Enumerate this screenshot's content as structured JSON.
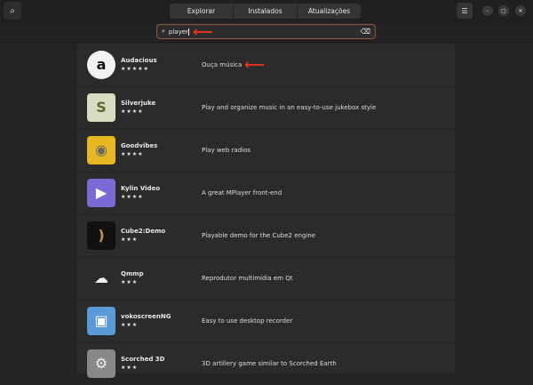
{
  "header": {
    "tabs": [
      "Explorar",
      "Instalados",
      "Atualizações"
    ]
  },
  "search": {
    "value": "player"
  },
  "apps": [
    {
      "name": "Audacious",
      "stars": "★★★★★",
      "desc": "Ouça música",
      "icon": "audacious-icon",
      "bg": "#f2f2f2",
      "glyph": "a",
      "fg": "#111"
    },
    {
      "name": "Silverjuke",
      "stars": "★★★★",
      "desc": "Play and organize music in an easy-to-use jukebox style",
      "icon": "silverjuke-icon",
      "bg": "#d8dcc0",
      "glyph": "S",
      "fg": "#5a6a30"
    },
    {
      "name": "Goodvibes",
      "stars": "★★★★",
      "desc": "Play web radios",
      "icon": "radio-icon",
      "bg": "#e8b820",
      "glyph": "◉",
      "fg": "#666"
    },
    {
      "name": "Kylin Video",
      "stars": "★★★★",
      "desc": "A great MPlayer front-end",
      "icon": "play-icon",
      "bg": "#7a6ad8",
      "glyph": "▶",
      "fg": "#fff"
    },
    {
      "name": "Cube2:Demo",
      "stars": "★★★",
      "desc": "Playable demo for the Cube2 engine",
      "icon": "cube2-icon",
      "bg": "#111",
      "glyph": ")",
      "fg": "#c89040"
    },
    {
      "name": "Qmmp",
      "stars": "★★★",
      "desc": "Reprodutor multimídia em Qt",
      "icon": "qmmp-icon",
      "bg": "#2b2b2b",
      "glyph": "☁",
      "fg": "#eee"
    },
    {
      "name": "vokoscreenNG",
      "stars": "★★★",
      "desc": "Easy to use desktop recorder",
      "icon": "vokoscreen-icon",
      "bg": "#5a9ad8",
      "glyph": "▣",
      "fg": "#fff"
    },
    {
      "name": "Scorched 3D",
      "stars": "★★★",
      "desc": "3D artillery game similar to Scorched Earth",
      "icon": "scorched-icon",
      "bg": "#888",
      "glyph": "⚙",
      "fg": "#eee"
    }
  ]
}
